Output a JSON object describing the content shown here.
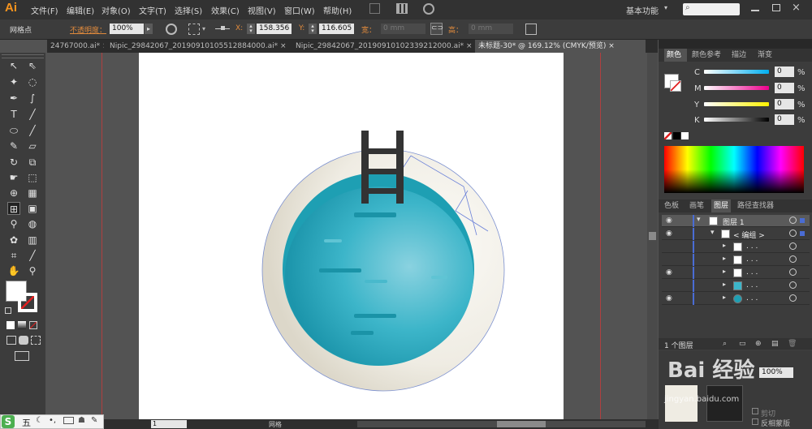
{
  "app": {
    "logo": "Ai"
  },
  "menu": {
    "items": [
      "文件(F)",
      "编辑(E)",
      "对象(O)",
      "文字(T)",
      "选择(S)",
      "效果(C)",
      "视图(V)",
      "窗口(W)",
      "帮助(H)"
    ],
    "workspace": "基本功能"
  },
  "control": {
    "mode_label": "网格点",
    "opacity_label": "不透明度：",
    "opacity_value": "100%",
    "x_label": "X:",
    "x_value": "158.356",
    "y_label": "Y:",
    "y_value": "116.605",
    "w_label": "宽：",
    "w_value": "0 mm",
    "h_label": "高：",
    "h_value": "0 mm"
  },
  "tabs": [
    {
      "label": "24767000.ai*",
      "close": "×"
    },
    {
      "label": "Nipic_29842067_20190910105512884000.ai*",
      "close": "×"
    },
    {
      "label": "Nipic_29842067_20190910102339212000.ai*",
      "close": "×"
    },
    {
      "label": "未标题-30* @ 169.12% (CMYK/预览)",
      "close": "×"
    }
  ],
  "color_panel": {
    "tabs": [
      "颜色",
      "颜色参考",
      "描边",
      "渐变"
    ],
    "channels": [
      {
        "name": "C",
        "value": "0",
        "unit": "%"
      },
      {
        "name": "M",
        "value": "0",
        "unit": "%"
      },
      {
        "name": "Y",
        "value": "0",
        "unit": "%"
      },
      {
        "name": "K",
        "value": "0",
        "unit": "%"
      }
    ]
  },
  "layers_panel": {
    "tabs": [
      "色板",
      "画笔",
      "图层",
      "路径查找器"
    ],
    "layer_name": "图层 1",
    "group_name": "< 编组 >",
    "sublayer_label": ". . .",
    "footer_count": "1 个图层"
  },
  "lower_panel": {
    "opacity_value": "100%",
    "clip_label": "剪切",
    "invert_label": "反相蒙版",
    "watermark": "Bai 经验",
    "watermark_url": "jingyan.baidu.com"
  },
  "status": {
    "zoom": "169.12%",
    "page": "1",
    "mode": "网格"
  },
  "taskbar": {
    "ime": "五"
  }
}
